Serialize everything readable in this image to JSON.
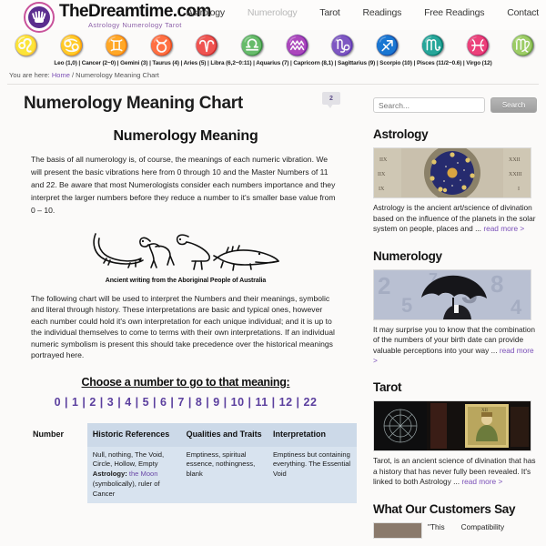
{
  "site": {
    "logo_title": "TheDreamtime.com",
    "logo_tagline": "Astrology Numerology Tarot",
    "logo_icon": "hand-in-circle-logo"
  },
  "topnav": {
    "items": [
      {
        "label": "Astrology",
        "active": false
      },
      {
        "label": "Numerology",
        "active": true
      },
      {
        "label": "Tarot",
        "active": false
      },
      {
        "label": "Readings",
        "active": false
      },
      {
        "label": "Free Readings",
        "active": false
      },
      {
        "label": "Contact",
        "active": false
      }
    ]
  },
  "zodiac": {
    "icons": [
      {
        "name": "leo-icon",
        "glyph": "♌"
      },
      {
        "name": "cancer-icon",
        "glyph": "♋"
      },
      {
        "name": "gemini-icon",
        "glyph": "♊"
      },
      {
        "name": "taurus-icon",
        "glyph": "♉"
      },
      {
        "name": "aries-icon",
        "glyph": "♈"
      },
      {
        "name": "libra-icon",
        "glyph": "♎"
      },
      {
        "name": "aquarius-icon",
        "glyph": "♒"
      },
      {
        "name": "capricorn-icon",
        "glyph": "♑"
      },
      {
        "name": "sagittarius-icon",
        "glyph": "♐"
      },
      {
        "name": "scorpio-icon",
        "glyph": "♏"
      },
      {
        "name": "pisces-icon",
        "glyph": "♓"
      },
      {
        "name": "virgo-icon",
        "glyph": "♍"
      }
    ],
    "legend": "Leo (1,0) | Cancer (2~0) | Gemini (3) | Taurus (4) | Aries (5) | Libra (6,2~0:11) | Aquarius (7) | Capricorn (8,1) | Sagittarius (9) | Scorpio (10) | Pisces (11/2~0.6) | Virgo (12)"
  },
  "breadcrumb": {
    "prefix": "You are here:",
    "home": "Home",
    "separator": "/",
    "current": "Numerology Meaning Chart"
  },
  "main": {
    "page_title": "Numerology Meaning Chart",
    "comment_count": "2",
    "section_title": "Numerology Meaning",
    "intro_paragraph": "The basis of all numerology is, of course, the meanings of each numeric vibration. We will present the basic vibrations here from 0 through 10 and the Master Numbers of 11 and 22. Be aware that most Numerologists consider each numbers importance and they interpret the larger numbers before they reduce a number to it's smaller base value from 0 – 10.",
    "image_caption": "Ancient writing from the Aboriginal People of Australia",
    "image_name": "aboriginal-rock-art-animals",
    "second_paragraph": "The following chart will be used to interpret the Numbers and their meanings, symbolic and literal through history. These interpretations are basic and typical ones, however each number could hold it's own interpretation for each unique individual; and it is up to the individual themselves to come to terms with their own interpretations. If an individual numeric symbolism is present this should take precedence over the historical meanings portrayed here.",
    "choose_title": "Choose a number to go to that meaning:",
    "number_links": [
      "0",
      "1",
      "2",
      "3",
      "4",
      "5",
      "6",
      "7",
      "8",
      "9",
      "10",
      "11",
      "12",
      "22"
    ]
  },
  "table": {
    "headers": [
      "Number",
      "Historic References",
      "Qualities and Traits",
      "Interpretation"
    ],
    "rows": [
      {
        "number": "",
        "historic_plain": "Null, nothing, The Void, Circle, Hollow, Empty",
        "historic_label": "Astrology:",
        "historic_link": "the Moon",
        "historic_tail": "(symbolically), ruler of Cancer",
        "qualities": "Emptiness, spiritual essence, nothingness, blank",
        "interpretation": "Emptiness but containing everything. The Essential Void"
      }
    ]
  },
  "sidebar": {
    "search": {
      "placeholder": "Search...",
      "value": "",
      "button_label": "Search"
    },
    "blocks": [
      {
        "title": "Astrology",
        "image_name": "zodiac-wheel-photo",
        "text": "Astrology is the ancient art/science of divination based on the influence of the planets in the solar system on people, places and ...",
        "read_more": "read more >"
      },
      {
        "title": "Numerology",
        "image_name": "umbrella-numbers-photo",
        "text": "It may surprise you to know that the combination of the numbers of your birth date can provide valuable perceptions into your way ...",
        "read_more": "read more >"
      },
      {
        "title": "Tarot",
        "image_name": "tarot-cards-photo",
        "text": "Tarot, is an ancient science of divination that has a history that has never fully been revealed. It's linked to both Astrology ...",
        "read_more": "read more >"
      }
    ],
    "testimonials_title": "What Our Customers Say",
    "testimonial_snippet_left": "\"This",
    "testimonial_snippet_right": "Compatibility"
  },
  "colors": {
    "link_purple": "#6b4aa8",
    "logo_purple": "#5b2d8e",
    "logo_ring_pink": "#c9539b",
    "table_header_blue": "#ccd9e8",
    "table_cell_blue": "#d8e3ef"
  }
}
